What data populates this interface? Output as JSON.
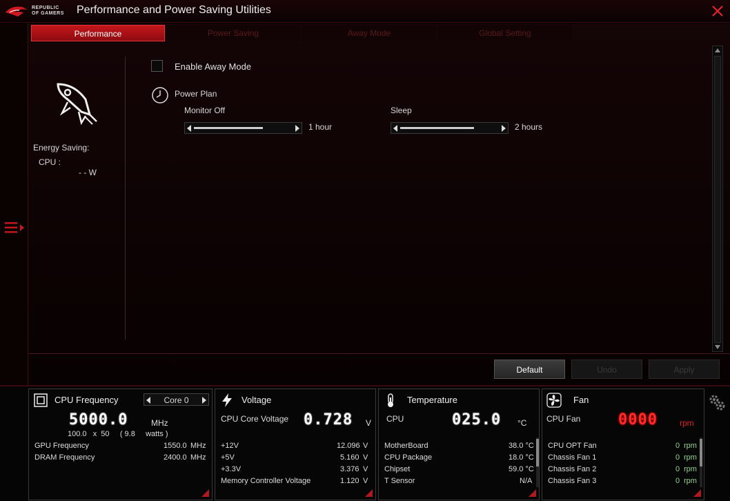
{
  "window": {
    "title": "Performance and Power Saving Utilities",
    "logo_text": "REPUBLIC OF GAMERS"
  },
  "tabs": [
    {
      "label": "Performance",
      "active": true
    },
    {
      "label": "Power Saving",
      "active": false
    },
    {
      "label": "Away Mode",
      "active": false
    },
    {
      "label": "Global Setting",
      "active": false
    }
  ],
  "side_info": {
    "energy_label": "Energy Saving:",
    "cpu_label": "CPU :",
    "cpu_watts": "- - W"
  },
  "away": {
    "enable_label": "Enable Away Mode",
    "enabled": false,
    "power_plan_label": "Power Plan",
    "monitor_off_label": "Monitor Off",
    "monitor_off_value": "1 hour",
    "monitor_off_level": 0.7,
    "sleep_label": "Sleep",
    "sleep_value": "2 hours",
    "sleep_level": 0.75
  },
  "buttons": {
    "default": "Default",
    "undo": "Undo",
    "apply": "Apply"
  },
  "cpu_freq": {
    "title": "CPU Frequency",
    "core": "Core 0",
    "value": "5000.0",
    "unit": "MHz",
    "ratio": "100.0   x  50     ( 9.8     watts )",
    "rows": [
      {
        "label": "GPU Frequency",
        "value": "1550.0",
        "unit": "MHz"
      },
      {
        "label": "DRAM Frequency",
        "value": "2400.0",
        "unit": "MHz"
      }
    ]
  },
  "voltage": {
    "title": "Voltage",
    "main_label": "CPU Core Voltage",
    "main_value": "0.728",
    "main_unit": "V",
    "rows": [
      {
        "label": "+12V",
        "value": "12.096",
        "unit": "V"
      },
      {
        "label": "+5V",
        "value": "5.160",
        "unit": "V"
      },
      {
        "label": "+3.3V",
        "value": "3.376",
        "unit": "V"
      },
      {
        "label": "Memory Controller Voltage",
        "value": "1.120",
        "unit": "V"
      }
    ]
  },
  "temperature": {
    "title": "Temperature",
    "main_label": "CPU",
    "main_value": "025.0",
    "main_unit": "°C",
    "rows": [
      {
        "label": "MotherBoard",
        "value": "38.0 °C"
      },
      {
        "label": "CPU Package",
        "value": "18.0 °C"
      },
      {
        "label": "Chipset",
        "value": "59.0 °C"
      },
      {
        "label": "T Sensor",
        "value": "N/A"
      }
    ]
  },
  "fan": {
    "title": "Fan",
    "main_label": "CPU Fan",
    "main_value": "0000",
    "main_unit": "rpm",
    "rows": [
      {
        "label": "CPU OPT Fan",
        "value": "0",
        "unit": "rpm"
      },
      {
        "label": "Chassis Fan 1",
        "value": "0",
        "unit": "rpm"
      },
      {
        "label": "Chassis Fan 2",
        "value": "0",
        "unit": "rpm"
      },
      {
        "label": "Chassis Fan 3",
        "value": "0",
        "unit": "rpm"
      }
    ]
  },
  "colors": {
    "accent": "#c4161c",
    "background": "#0a0202",
    "fan_alert": "#ff2b2b"
  }
}
